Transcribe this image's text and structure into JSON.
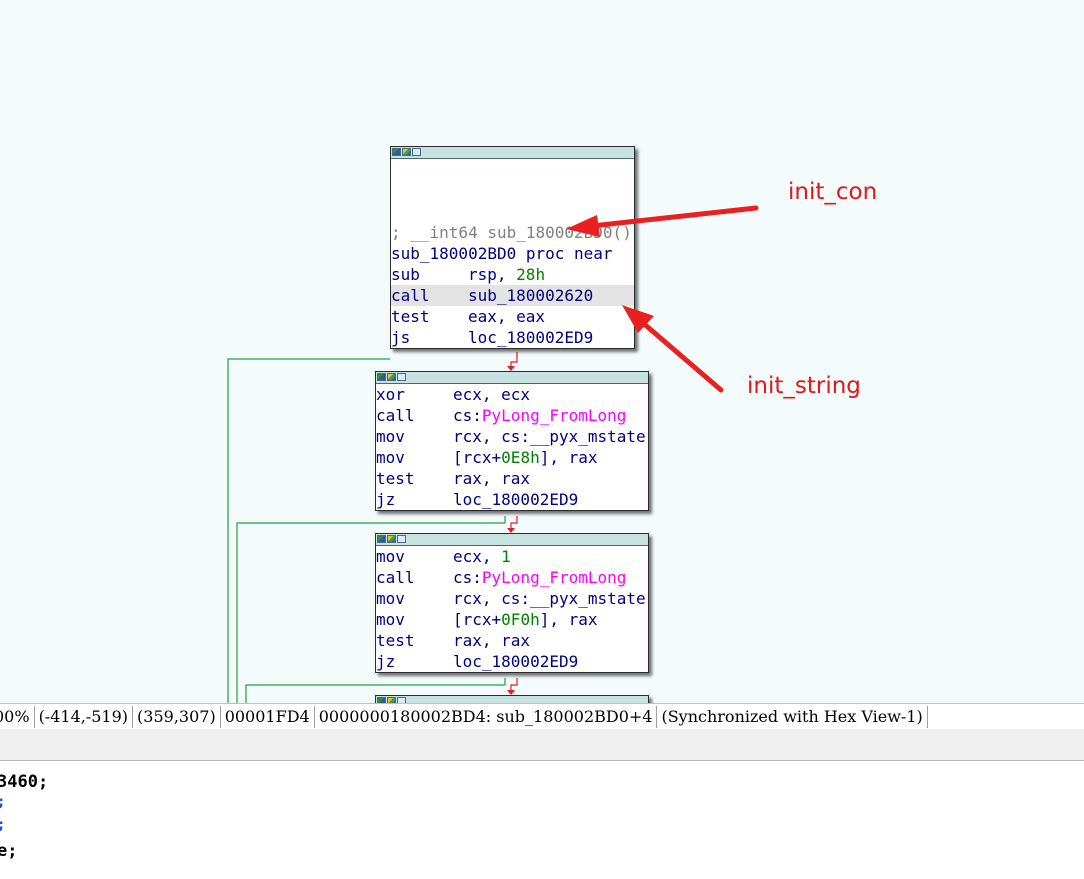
{
  "graph": {
    "nodes": [
      {
        "id": "block-1",
        "lines": [
          {
            "kind": "blank"
          },
          {
            "kind": "blank"
          },
          {
            "kind": "blank"
          },
          {
            "kind": "comment",
            "text": "; __int64 sub_180002BD0()"
          },
          {
            "kind": "label",
            "text": "sub_180002BD0 proc near"
          },
          {
            "kind": "instr",
            "mnemonic": "sub",
            "parts": [
              {
                "t": "rsp, "
              },
              {
                "t": "28h",
                "c": "num"
              }
            ]
          },
          {
            "kind": "instr",
            "mnemonic": "call",
            "highlight": true,
            "parts": [
              {
                "t": "sub_180002620"
              }
            ]
          },
          {
            "kind": "instr",
            "mnemonic": "test",
            "parts": [
              {
                "t": "eax, eax"
              }
            ]
          },
          {
            "kind": "instr",
            "mnemonic": "js",
            "parts": [
              {
                "t": "loc_180002ED9"
              }
            ]
          }
        ]
      },
      {
        "id": "block-2",
        "lines": [
          {
            "kind": "instr",
            "mnemonic": "xor",
            "parts": [
              {
                "t": "ecx, ecx"
              }
            ]
          },
          {
            "kind": "instr",
            "mnemonic": "call",
            "parts": [
              {
                "t": "cs:"
              },
              {
                "t": "PyLong_FromLong",
                "c": "imp"
              }
            ]
          },
          {
            "kind": "instr",
            "mnemonic": "mov",
            "parts": [
              {
                "t": "rcx, cs:__pyx_mstate"
              }
            ]
          },
          {
            "kind": "instr",
            "mnemonic": "mov",
            "parts": [
              {
                "t": "[rcx+"
              },
              {
                "t": "0E8h",
                "c": "num"
              },
              {
                "t": "], rax"
              }
            ]
          },
          {
            "kind": "instr",
            "mnemonic": "test",
            "parts": [
              {
                "t": "rax, rax"
              }
            ]
          },
          {
            "kind": "instr",
            "mnemonic": "jz",
            "parts": [
              {
                "t": "loc_180002ED9"
              }
            ]
          }
        ]
      },
      {
        "id": "block-3",
        "lines": [
          {
            "kind": "instr",
            "mnemonic": "mov",
            "parts": [
              {
                "t": "ecx, "
              },
              {
                "t": "1",
                "c": "num"
              }
            ]
          },
          {
            "kind": "instr",
            "mnemonic": "call",
            "parts": [
              {
                "t": "cs:"
              },
              {
                "t": "PyLong_FromLong",
                "c": "imp"
              }
            ]
          },
          {
            "kind": "instr",
            "mnemonic": "mov",
            "parts": [
              {
                "t": "rcx, cs:__pyx_mstate"
              }
            ]
          },
          {
            "kind": "instr",
            "mnemonic": "mov",
            "parts": [
              {
                "t": "[rcx+"
              },
              {
                "t": "0F0h",
                "c": "num"
              },
              {
                "t": "], rax"
              }
            ]
          },
          {
            "kind": "instr",
            "mnemonic": "test",
            "parts": [
              {
                "t": "rax, rax"
              }
            ]
          },
          {
            "kind": "instr",
            "mnemonic": "jz",
            "parts": [
              {
                "t": "loc_180002ED9"
              }
            ]
          }
        ]
      },
      {
        "id": "block-4",
        "lines": []
      }
    ],
    "annotations": [
      {
        "id": "init-con",
        "label": "init_con"
      },
      {
        "id": "init-string",
        "label": "init_string"
      }
    ]
  },
  "status_bar": {
    "segments": [
      "00%",
      "(-414,-519)",
      "(359,307)",
      "00001FD4",
      "0000000180002BD4: sub_180002BD0+4",
      "(Synchronized with Hex View-1)"
    ]
  },
  "code_view": {
    "lines": [
      "3460;",
      ";",
      ";",
      "e;"
    ]
  },
  "colors": {
    "graph_bg": "#f4fbfd",
    "node_title": "#c8e2e2",
    "mnemonic": "#000080",
    "number": "#008000",
    "import": "#ff00ff",
    "comment": "#808080",
    "edge": "#22a040",
    "branch_edge": "#e02020",
    "annotation": "#e01818"
  }
}
